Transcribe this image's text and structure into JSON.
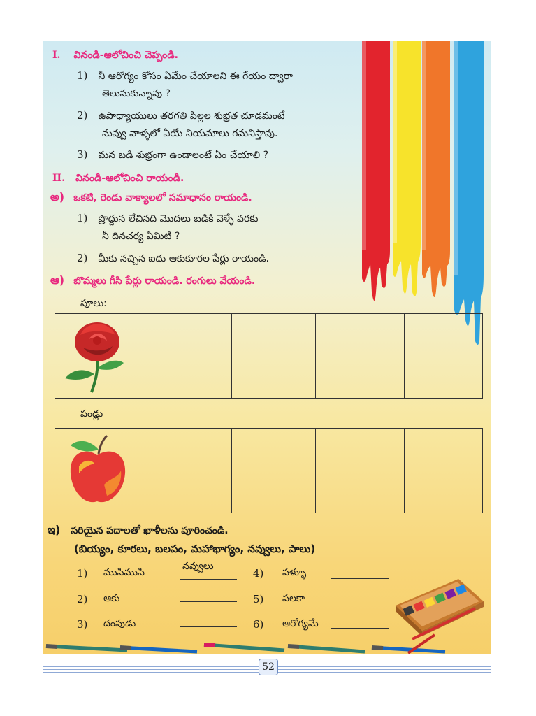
{
  "section1": {
    "roman": "I.",
    "title": "వినండి-ఆలోచించి చెప్పండి.",
    "items": [
      {
        "num": "1)",
        "lines": [
          "నీ ఆరోగ్యం కోసం ఏమేం చేయాలని ఈ గేయం ద్వారా",
          "తెలుసుకున్నావు ?"
        ]
      },
      {
        "num": "2)",
        "lines": [
          "ఉపాధ్యాయులు తరగతి పిల్లల శుభ్రత చూడమంటే",
          "నువ్వు వాళ్ళలో ఏయే నియమాలు గమనిస్తావు."
        ]
      },
      {
        "num": "3)",
        "lines": [
          "మన బడి శుభ్రంగా ఉండాలంటే ఏం చేయాలి ?"
        ]
      }
    ]
  },
  "section2": {
    "roman": "II.",
    "title": "వినండి-ఆలోచించి రాయండి.",
    "sub_a": {
      "label": "అ)",
      "title": "ఒకటి, రెండు వాక్యాలలో సమాధానం రాయండి."
    },
    "items": [
      {
        "num": "1)",
        "lines": [
          "ప్రొద్దున లేచినది మొదలు బడికి వెళ్ళే వరకు",
          "నీ దినచర్య ఏమిటి ?"
        ]
      },
      {
        "num": "2)",
        "lines": [
          "మీకు నచ్చిన ఐదు ఆకుకూరల పేర్లు రాయండి."
        ]
      }
    ],
    "sub_aa": {
      "label": "ఆ)",
      "title": "బొమ్మలు గీసి పేర్లు రాయండి. రంగులు వేయండి."
    }
  },
  "flowers_label": "పూలు:",
  "fruits_label": "పండ్లు",
  "section_i": {
    "label": "ఇ)",
    "title": "సరియైన పదాలతో ఖాళీలను పూరించండి.",
    "options": "(బియ్యం, కూరలు, బలపం, మహాభాగ్యం, నవ్వులు, పాలు)",
    "blanks": [
      {
        "num": "1)",
        "word": "ముసిముసి",
        "answer": "నవ్వులు"
      },
      {
        "num": "2)",
        "word": "ఆకు",
        "answer": ""
      },
      {
        "num": "3)",
        "word": "దంపుడు",
        "answer": ""
      },
      {
        "num": "4)",
        "word": "పళ్ళూ",
        "answer": ""
      },
      {
        "num": "5)",
        "word": "పలకా",
        "answer": ""
      },
      {
        "num": "6)",
        "word": "ఆరోగ్యమే",
        "answer": ""
      }
    ]
  },
  "page_number": "52",
  "colors": {
    "heading": "#e8287e",
    "paint": [
      "#e2242d",
      "#f7e32b",
      "#f0762a",
      "#2fa3dd"
    ]
  }
}
